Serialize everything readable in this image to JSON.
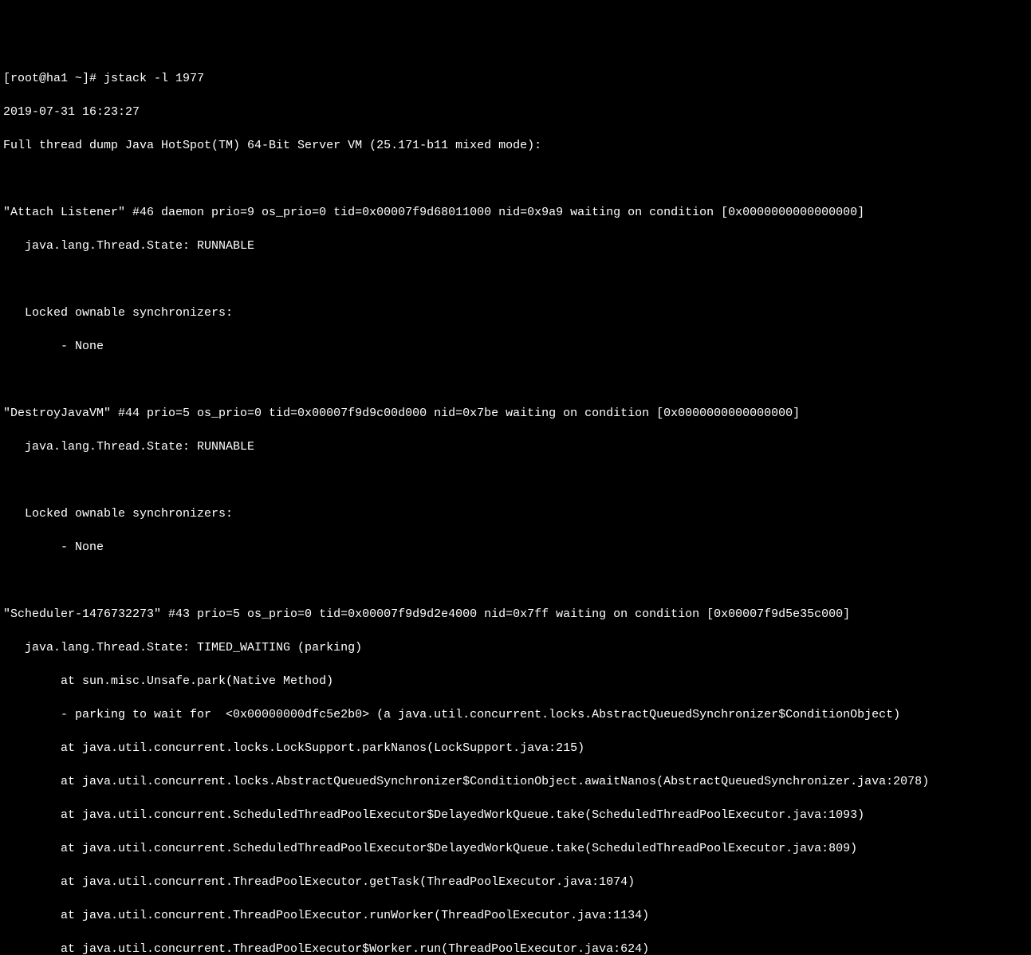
{
  "prompt": "[root@ha1 ~]# ",
  "command": "jstack -l 1977",
  "timestamp": "2019-07-31 16:23:27",
  "header": "Full thread dump Java HotSpot(TM) 64-Bit Server VM (25.171-b11 mixed mode):",
  "threads": [
    {
      "title": "\"Attach Listener\" #46 daemon prio=9 os_prio=0 tid=0x00007f9d68011000 nid=0x9a9 waiting on condition [0x0000000000000000]",
      "state": "   java.lang.Thread.State: RUNNABLE",
      "locked_header": "   Locked ownable synchronizers:",
      "locked_items": [
        "        - None"
      ]
    },
    {
      "title": "\"DestroyJavaVM\" #44 prio=5 os_prio=0 tid=0x00007f9d9c00d000 nid=0x7be waiting on condition [0x0000000000000000]",
      "state": "   java.lang.Thread.State: RUNNABLE",
      "locked_header": "   Locked ownable synchronizers:",
      "locked_items": [
        "        - None"
      ]
    },
    {
      "title": "\"Scheduler-1476732273\" #43 prio=5 os_prio=0 tid=0x00007f9d9d2e4000 nid=0x7ff waiting on condition [0x00007f9d5e35c000]",
      "state": "   java.lang.Thread.State: TIMED_WAITING (parking)",
      "stack": [
        "        at sun.misc.Unsafe.park(Native Method)",
        "        - parking to wait for  <0x00000000dfc5e2b0> (a java.util.concurrent.locks.AbstractQueuedSynchronizer$ConditionObject)",
        "        at java.util.concurrent.locks.LockSupport.parkNanos(LockSupport.java:215)",
        "        at java.util.concurrent.locks.AbstractQueuedSynchronizer$ConditionObject.awaitNanos(AbstractQueuedSynchronizer.java:2078)",
        "        at java.util.concurrent.ScheduledThreadPoolExecutor$DelayedWorkQueue.take(ScheduledThreadPoolExecutor.java:1093)",
        "        at java.util.concurrent.ScheduledThreadPoolExecutor$DelayedWorkQueue.take(ScheduledThreadPoolExecutor.java:809)",
        "        at java.util.concurrent.ThreadPoolExecutor.getTask(ThreadPoolExecutor.java:1074)",
        "        at java.util.concurrent.ThreadPoolExecutor.runWorker(ThreadPoolExecutor.java:1134)",
        "        at java.util.concurrent.ThreadPoolExecutor$Worker.run(ThreadPoolExecutor.java:624)"
      ]
    }
  ]
}
